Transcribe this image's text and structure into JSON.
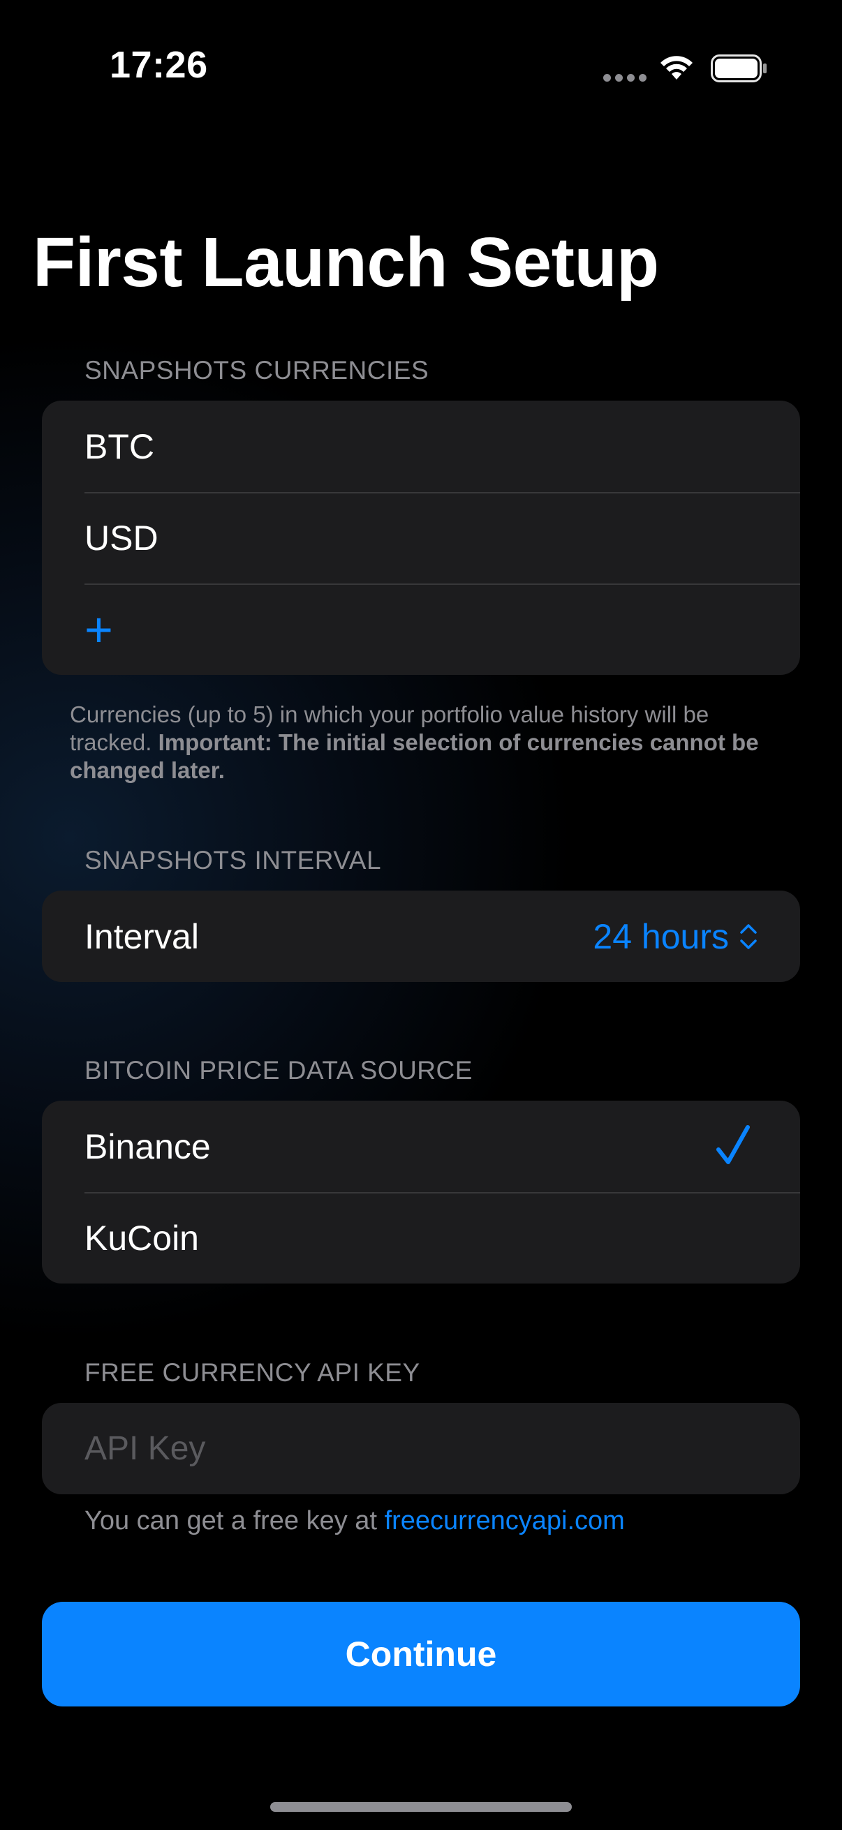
{
  "status_bar": {
    "time": "17:26"
  },
  "page": {
    "title": "First Launch Setup"
  },
  "snapshots_currencies": {
    "header": "SNAPSHOTS CURRENCIES",
    "items": [
      "BTC",
      "USD"
    ],
    "add_label": "+",
    "footnote_regular": "Currencies (up to 5) in which your portfolio value history will be tracked. ",
    "footnote_bold": "Important: The initial selection of currencies cannot be changed later."
  },
  "snapshots_interval": {
    "header": "SNAPSHOTS INTERVAL",
    "label": "Interval",
    "value": "24 hours"
  },
  "price_source": {
    "header": "BITCOIN PRICE DATA SOURCE",
    "options": [
      {
        "label": "Binance",
        "selected": true
      },
      {
        "label": "KuCoin",
        "selected": false
      }
    ]
  },
  "api_key": {
    "header": "FREE CURRENCY API KEY",
    "value": "",
    "placeholder": "API Key",
    "note_prefix": "You can get a free key at ",
    "note_link": "freecurrencyapi.com"
  },
  "actions": {
    "continue_label": "Continue"
  },
  "colors": {
    "accent": "#0a84ff",
    "card": "#1c1c1e",
    "secondary_text": "#8e8e93"
  }
}
